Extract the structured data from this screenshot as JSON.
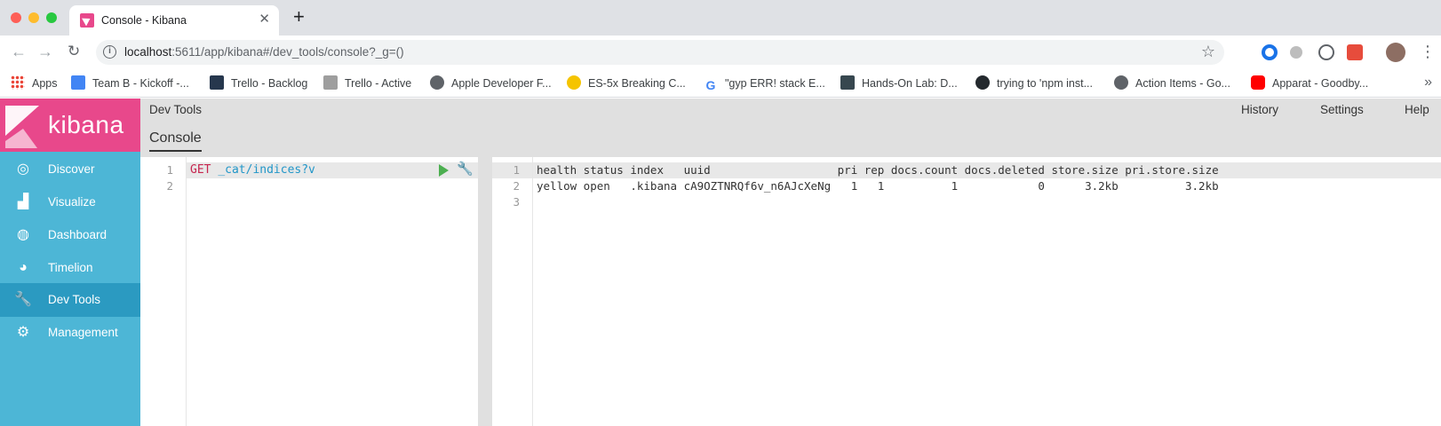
{
  "browser": {
    "tab": {
      "title": "Console - Kibana",
      "close": "✕"
    },
    "new_tab": "+",
    "url_host": "localhost",
    "url_rest": ":5611/app/kibana#/dev_tools/console?_g=()",
    "bookmarks": [
      {
        "label": "Apps"
      },
      {
        "label": "Team B - Kickoff -..."
      },
      {
        "label": "Trello - Backlog"
      },
      {
        "label": "Trello - Active"
      },
      {
        "label": "Apple Developer F..."
      },
      {
        "label": "ES-5x Breaking C..."
      },
      {
        "label": "\"gyp ERR! stack E..."
      },
      {
        "label": "Hands-On Lab: D..."
      },
      {
        "label": "trying to 'npm inst..."
      },
      {
        "label": "Action Items - Go..."
      },
      {
        "label": "Apparat - Goodby..."
      }
    ],
    "bookmarks_more": "»"
  },
  "kibana": {
    "logo": "kibana",
    "nav": [
      {
        "label": "Discover",
        "icon": "compass-icon"
      },
      {
        "label": "Visualize",
        "icon": "bar-chart-icon"
      },
      {
        "label": "Dashboard",
        "icon": "gauge-icon"
      },
      {
        "label": "Timelion",
        "icon": "timelion-icon"
      },
      {
        "label": "Dev Tools",
        "icon": "wrench-icon",
        "active": true
      },
      {
        "label": "Management",
        "icon": "gear-icon"
      }
    ],
    "topbar": {
      "title": "Dev Tools",
      "history": "History",
      "settings": "Settings",
      "help": "Help"
    },
    "subbar": {
      "tab": "Console"
    },
    "editor": {
      "line_numbers": [
        "1",
        "2"
      ],
      "method": "GET",
      "path": "_cat/indices?v"
    },
    "output": {
      "line_numbers": [
        "1",
        "2",
        "3"
      ],
      "lines": [
        "health status index   uuid                   pri rep docs.count docs.deleted store.size pri.store.size",
        "yellow open   .kibana cA9OZTNRQf6v_n6AJcXeNg   1   1          1            0      3.2kb          3.2kb",
        ""
      ]
    }
  }
}
